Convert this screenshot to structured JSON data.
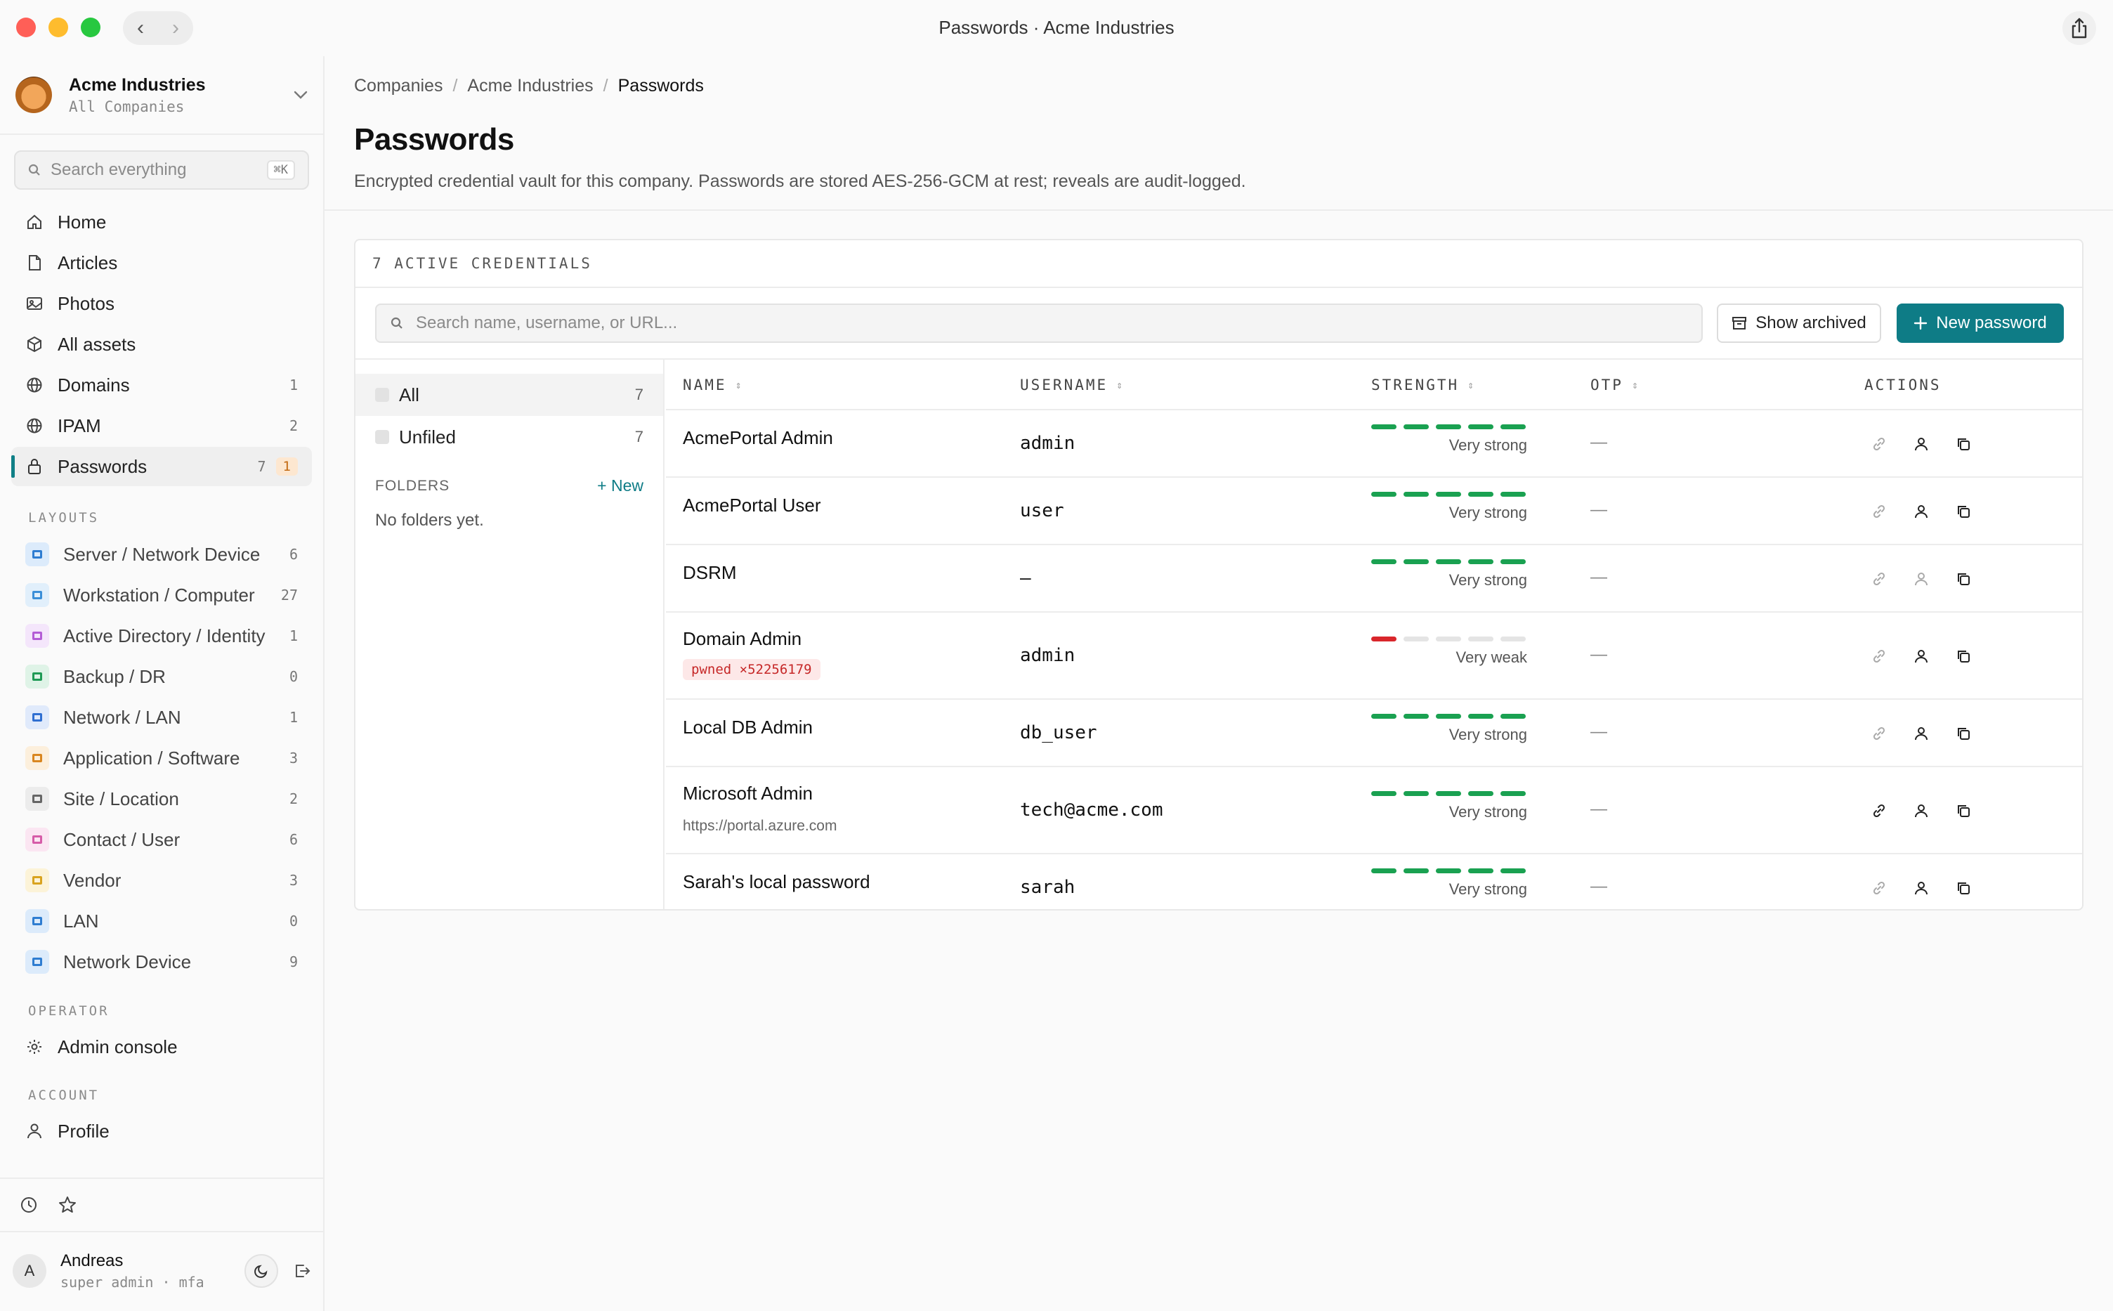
{
  "window": {
    "title": "Passwords · Acme Industries"
  },
  "company": {
    "name": "Acme Industries",
    "subtitle": "All Companies"
  },
  "sidebar": {
    "search": {
      "placeholder": "Search everything",
      "shortcut": "⌘K"
    },
    "nav": [
      {
        "label": "Home",
        "icon": "home-icon",
        "count": ""
      },
      {
        "label": "Articles",
        "icon": "document-icon",
        "count": ""
      },
      {
        "label": "Photos",
        "icon": "image-icon",
        "count": ""
      },
      {
        "label": "All assets",
        "icon": "cube-icon",
        "count": ""
      },
      {
        "label": "Domains",
        "icon": "globe-icon",
        "count": "1"
      },
      {
        "label": "IPAM",
        "icon": "globe-icon",
        "count": "2"
      },
      {
        "label": "Passwords",
        "icon": "lock-icon",
        "count": "7",
        "badge": "1"
      }
    ],
    "layouts_label": "LAYOUTS",
    "layouts": [
      {
        "label": "Server / Network Device",
        "count": "6",
        "color": "#2f7dd1",
        "bg": "#dcebfb"
      },
      {
        "label": "Workstation / Computer",
        "count": "27",
        "color": "#3b8fd8",
        "bg": "#e1effb"
      },
      {
        "label": "Active Directory / Identity",
        "count": "1",
        "color": "#b45dd6",
        "bg": "#f4e6fb"
      },
      {
        "label": "Backup / DR",
        "count": "0",
        "color": "#1f9a55",
        "bg": "#dff3e7"
      },
      {
        "label": "Network / LAN",
        "count": "1",
        "color": "#2f6fd1",
        "bg": "#e0eafb"
      },
      {
        "label": "Application / Software",
        "count": "3",
        "color": "#d9861f",
        "bg": "#fcefdc"
      },
      {
        "label": "Site / Location",
        "count": "2",
        "color": "#666666",
        "bg": "#ececec"
      },
      {
        "label": "Contact / User",
        "count": "6",
        "color": "#d65ca8",
        "bg": "#fbe6f2"
      },
      {
        "label": "Vendor",
        "count": "3",
        "color": "#d9a31f",
        "bg": "#fcf3d8"
      },
      {
        "label": "LAN",
        "count": "0",
        "color": "#2f7dd1",
        "bg": "#dcebfb"
      },
      {
        "label": "Network Device",
        "count": "9",
        "color": "#2f7dd1",
        "bg": "#dcebfb"
      }
    ],
    "operator_label": "OPERATOR",
    "operator": {
      "label": "Admin console",
      "icon": "gear-icon"
    },
    "account_label": "ACCOUNT",
    "account": {
      "label": "Profile",
      "icon": "user-icon"
    }
  },
  "user": {
    "initial": "A",
    "name": "Andreas",
    "role": "super admin · mfa"
  },
  "breadcrumb": [
    "Companies",
    "Acme Industries",
    "Passwords"
  ],
  "page": {
    "title": "Passwords",
    "description": "Encrypted credential vault for this company. Passwords are stored AES-256-GCM at rest; reveals are audit-logged."
  },
  "card": {
    "heading": "7 ACTIVE CREDENTIALS",
    "search_placeholder": "Search name, username, or URL...",
    "show_archived": "Show archived",
    "new_password": "New password"
  },
  "folders": {
    "items": [
      {
        "label": "All",
        "count": "7"
      },
      {
        "label": "Unfiled",
        "count": "7"
      }
    ],
    "label": "FOLDERS",
    "new_label": "+ New",
    "empty": "No folders yet."
  },
  "table": {
    "headers": {
      "name": "NAME",
      "username": "USERNAME",
      "strength": "STRENGTH",
      "otp": "OTP",
      "actions": "ACTIONS"
    },
    "rows": [
      {
        "name": "AcmePortal Admin",
        "username": "admin",
        "strength": 5,
        "strength_label": "Very strong",
        "otp": "—",
        "link_active": false,
        "user_active": true
      },
      {
        "name": "AcmePortal User",
        "username": "user",
        "strength": 5,
        "strength_label": "Very strong",
        "otp": "—",
        "link_active": false,
        "user_active": true
      },
      {
        "name": "DSRM",
        "username": "—",
        "strength": 5,
        "strength_label": "Very strong",
        "otp": "—",
        "link_active": false,
        "user_active": false
      },
      {
        "name": "Domain Admin",
        "pwned": "pwned ×52256179",
        "username": "admin",
        "strength": 1,
        "strength_label": "Very weak",
        "otp": "—",
        "link_active": false,
        "user_active": true
      },
      {
        "name": "Local DB Admin",
        "username": "db_user",
        "strength": 5,
        "strength_label": "Very strong",
        "otp": "—",
        "link_active": false,
        "user_active": true
      },
      {
        "name": "Microsoft Admin",
        "url": "https://portal.azure.com",
        "username": "tech@acme.com",
        "strength": 5,
        "strength_label": "Very strong",
        "otp": "—",
        "link_active": true,
        "user_active": true
      },
      {
        "name": "Sarah's local password",
        "username": "sarah",
        "strength": 5,
        "strength_label": "Very strong",
        "otp": "—",
        "link_active": false,
        "user_active": true
      }
    ]
  }
}
